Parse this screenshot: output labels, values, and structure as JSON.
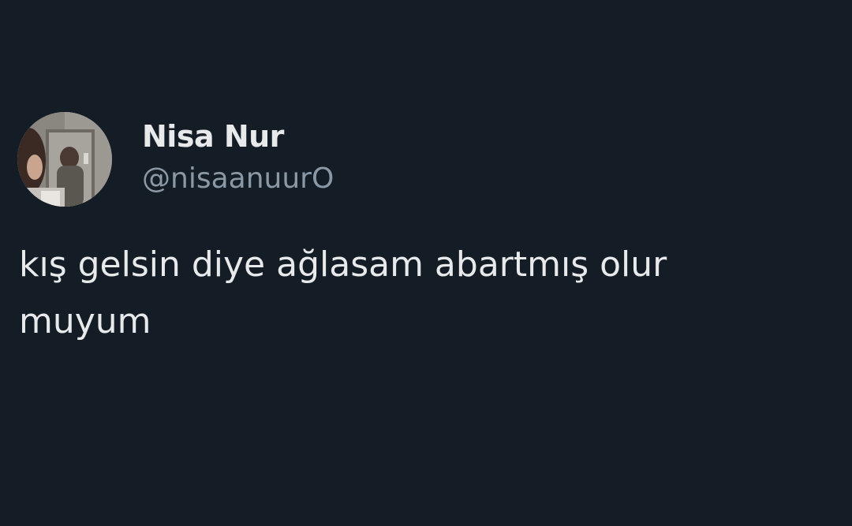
{
  "tweet": {
    "author": {
      "display_name": "Nisa Nur",
      "handle": "@nisaanuurO",
      "avatar_icon": "profile-photo"
    },
    "text": "kış gelsin diye ağlasam abartmış olur\nmuyum"
  },
  "colors": {
    "background": "#141d26",
    "primary_text": "#e7e9ea",
    "secondary_text": "#8b98a5"
  }
}
